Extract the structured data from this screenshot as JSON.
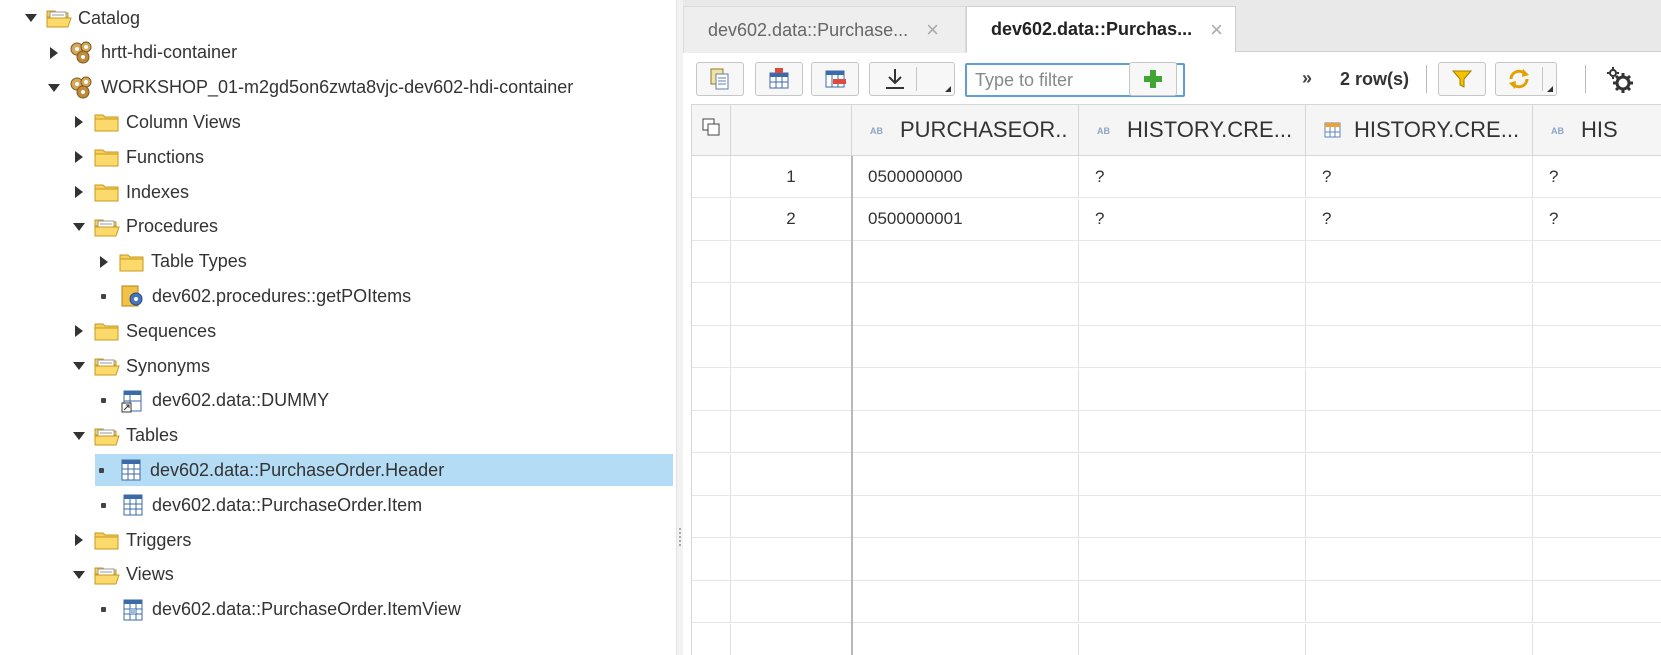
{
  "tree": {
    "items": [
      {
        "label": "Catalog",
        "level": 0,
        "twisty": "expanded",
        "icon": "folder-open-icon"
      },
      {
        "label": "hrtt-hdi-container",
        "level": 1,
        "twisty": "collapsed",
        "icon": "container-icon"
      },
      {
        "label": "WORKSHOP_01-m2gd5on6zwta8vjc-dev602-hdi-container",
        "level": 1,
        "twisty": "expanded",
        "icon": "container-icon"
      },
      {
        "label": "Column Views",
        "level": 2,
        "twisty": "collapsed",
        "icon": "folder-icon"
      },
      {
        "label": "Functions",
        "level": 2,
        "twisty": "collapsed",
        "icon": "folder-icon"
      },
      {
        "label": "Indexes",
        "level": 2,
        "twisty": "collapsed",
        "icon": "folder-icon"
      },
      {
        "label": "Procedures",
        "level": 2,
        "twisty": "expanded",
        "icon": "folder-open-icon"
      },
      {
        "label": "Table Types",
        "level": 3,
        "twisty": "collapsed",
        "icon": "folder-icon"
      },
      {
        "label": "dev602.procedures::getPOItems",
        "level": 3,
        "twisty": "leaf",
        "icon": "procedure-icon"
      },
      {
        "label": "Sequences",
        "level": 2,
        "twisty": "collapsed",
        "icon": "folder-icon"
      },
      {
        "label": "Synonyms",
        "level": 2,
        "twisty": "expanded",
        "icon": "folder-open-icon"
      },
      {
        "label": "dev602.data::DUMMY",
        "level": 3,
        "twisty": "leaf",
        "icon": "synonym-icon"
      },
      {
        "label": "Tables",
        "level": 2,
        "twisty": "expanded",
        "icon": "folder-open-icon"
      },
      {
        "label": "dev602.data::PurchaseOrder.Header",
        "level": 3,
        "twisty": "leaf",
        "icon": "table-icon",
        "selected": true
      },
      {
        "label": "dev602.data::PurchaseOrder.Item",
        "level": 3,
        "twisty": "leaf",
        "icon": "table-icon"
      },
      {
        "label": "Triggers",
        "level": 2,
        "twisty": "collapsed",
        "icon": "folder-icon"
      },
      {
        "label": "Views",
        "level": 2,
        "twisty": "expanded",
        "icon": "folder-open-icon"
      },
      {
        "label": "dev602.data::PurchaseOrder.ItemView",
        "level": 3,
        "twisty": "leaf",
        "icon": "view-icon"
      }
    ]
  },
  "tabs": [
    {
      "label": "dev602.data::Purchase...",
      "active": false
    },
    {
      "label": "dev602.data::Purchas...",
      "active": true
    }
  ],
  "toolbar": {
    "filter_placeholder": "Type to filter",
    "overflow_label": "»",
    "row_count": "2 row(s)"
  },
  "grid": {
    "columns": [
      {
        "label": "PURCHASEOR..",
        "type_icon": "text-type-icon"
      },
      {
        "label": "HISTORY.CRE...",
        "type_icon": "text-type-icon"
      },
      {
        "label": "HISTORY.CRE...",
        "type_icon": "date-type-icon"
      },
      {
        "label": "HIS",
        "type_icon": "text-type-icon"
      }
    ],
    "rows": [
      {
        "num": "1",
        "cells": [
          "0500000000",
          "?",
          "?",
          "?"
        ]
      },
      {
        "num": "2",
        "cells": [
          "0500000001",
          "?",
          "?",
          "?"
        ]
      }
    ]
  },
  "colors": {
    "selection": "#b5dcf5",
    "folder": "#f5c542",
    "filter_border": "#5b9fd6",
    "filter_icon": "#f5c200",
    "add_icon": "#3fa535"
  }
}
